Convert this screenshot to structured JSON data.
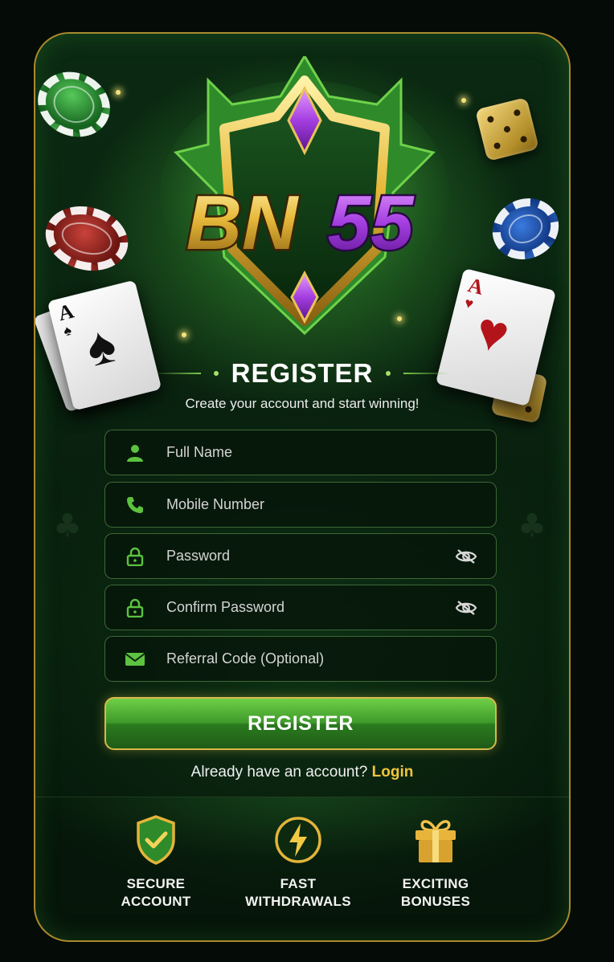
{
  "brand": {
    "logo_text_1": "BN",
    "logo_text_2": "55"
  },
  "header": {
    "title": "REGISTER",
    "subtitle": "Create your account and start winning!"
  },
  "form": {
    "fields": [
      {
        "placeholder": "Full Name",
        "icon": "user-icon",
        "value": ""
      },
      {
        "placeholder": "Mobile Number",
        "icon": "phone-icon",
        "value": ""
      },
      {
        "placeholder": "Password",
        "icon": "lock-icon",
        "value": "",
        "toggle": "eye-off-icon"
      },
      {
        "placeholder": "Confirm Password",
        "icon": "lock-icon",
        "value": "",
        "toggle": "eye-off-icon"
      },
      {
        "placeholder": "Referral Code (Optional)",
        "icon": "mail-icon",
        "value": ""
      }
    ],
    "submit_label": "REGISTER"
  },
  "login": {
    "prompt": "Already have an account?",
    "link_label": "Login"
  },
  "features": [
    {
      "line1": "SECURE",
      "line2": "ACCOUNT",
      "icon": "shield-check-icon"
    },
    {
      "line1": "FAST",
      "line2": "WITHDRAWALS",
      "icon": "lightning-icon"
    },
    {
      "line1": "EXCITING",
      "line2": "BONUSES",
      "icon": "gift-icon"
    }
  ],
  "decor": {
    "card_left_rank": "A",
    "card_right_rank": "A"
  },
  "colors": {
    "accent_green": "#5cc23f",
    "gold": "#f2c43a",
    "purple": "#9b3ad6",
    "background": "#061a0b"
  }
}
